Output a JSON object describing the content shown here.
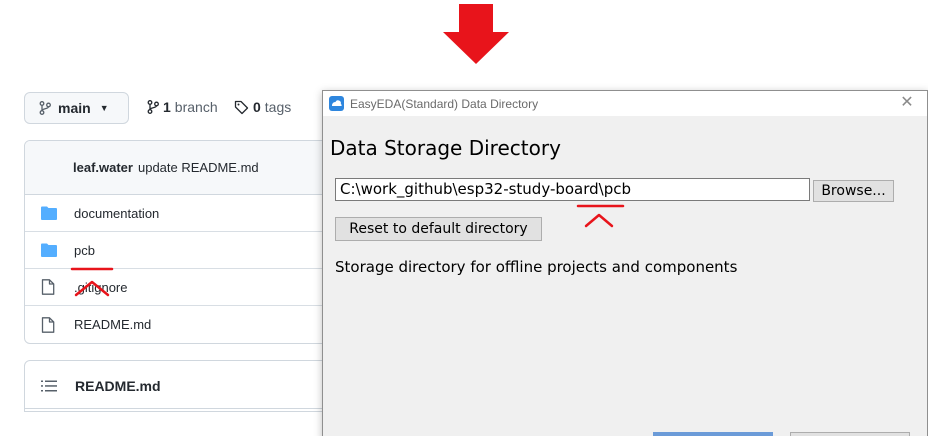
{
  "repo": {
    "branch_selector": {
      "label": "main"
    },
    "branches": {
      "count": "1",
      "label": "branch"
    },
    "tags": {
      "count": "0",
      "label": "tags"
    },
    "latest_commit": {
      "author": "leaf.water",
      "message": "update README.md"
    },
    "files": [
      {
        "name": "documentation",
        "type": "folder",
        "icon": "folder-icon"
      },
      {
        "name": "pcb",
        "type": "folder",
        "icon": "folder-icon"
      },
      {
        "name": ".gitignore",
        "type": "file",
        "icon": "file-icon"
      },
      {
        "name": "README.md",
        "type": "file",
        "icon": "file-icon"
      }
    ],
    "readme_header": {
      "label": "README.md",
      "icon": "list-icon"
    }
  },
  "dialog": {
    "title": "EasyEDA(Standard) Data Directory",
    "heading": "Data Storage Directory",
    "path_value": "C:\\work_github\\esp32-study-board\\pcb",
    "browse_label": "Browse...",
    "reset_label": "Reset to default directory",
    "description": "Storage directory for offline projects and components"
  },
  "colors": {
    "annotation_red": "#e8141b",
    "folder_blue": "#54aeff",
    "accent_blue": "#6b9bd8"
  }
}
